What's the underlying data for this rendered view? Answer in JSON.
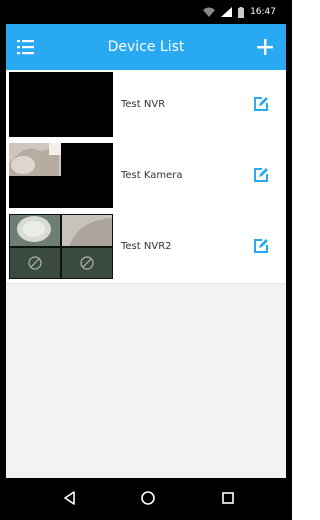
{
  "status_bar": {
    "time": "16:47"
  },
  "app_bar": {
    "title": "Device List",
    "menu_icon": "menu-icon",
    "add_icon": "plus-icon"
  },
  "devices": [
    {
      "name": "Test NVR"
    },
    {
      "name": "Test Kamera"
    },
    {
      "name": "Test NVR2"
    }
  ],
  "colors": {
    "app_bar": "#29a9f2",
    "edit_icon": "#29a9f2",
    "list_background": "#f2f2f2"
  },
  "nav_bar": {
    "icons": [
      "back-icon",
      "home-icon",
      "recents-icon"
    ]
  }
}
